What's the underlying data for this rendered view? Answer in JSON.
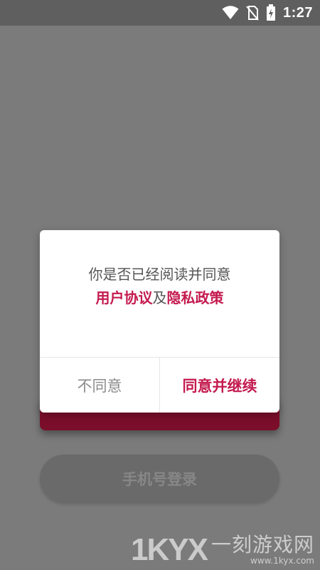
{
  "status_bar": {
    "time": "1:27",
    "icons": [
      "wifi-icon",
      "no-sim-icon",
      "battery-charging-icon"
    ]
  },
  "dialog": {
    "message_prefix": "你是否已经阅读并同意",
    "user_agreement_link": "用户协议",
    "conjunction": "及",
    "privacy_policy_link": "隐私政策",
    "disagree_label": "不同意",
    "agree_label": "同意并继续"
  },
  "background": {
    "login_button_label": "手机号登录"
  },
  "watermark": {
    "logo": "1KYX",
    "name": "一刻游戏网",
    "url": "www.1kyx.com"
  },
  "colors": {
    "accent": "#c41a4e",
    "overlay": "#7b7b7b",
    "status_bar": "#5f5f5f"
  }
}
